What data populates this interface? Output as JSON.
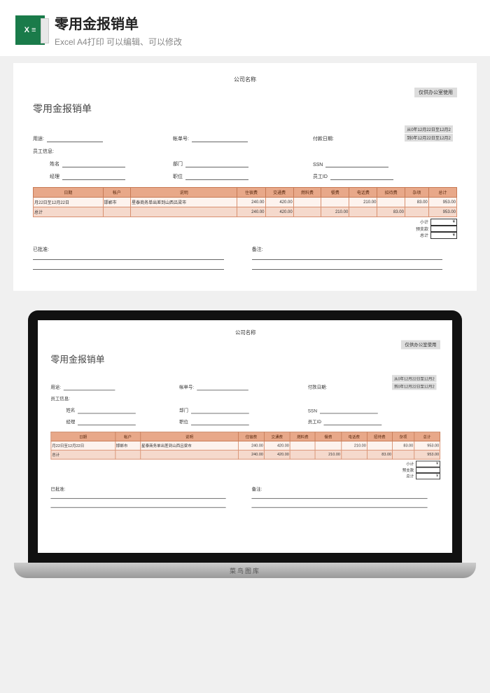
{
  "header": {
    "title": "零用金报销单",
    "subtitle": "Excel A4打印 可以编辑、可以修改"
  },
  "sheet": {
    "company": "公司名称",
    "topnote": "仅供办公室使用",
    "title": "零用金报销单",
    "purpose_label": "用途:",
    "statement_no_label": "帐单号:",
    "payperiod_label": "付款日期:",
    "from_prefix": "从",
    "to_prefix": "到",
    "date_value": "0年12月22日至12月2",
    "emp_label": "员工信息:",
    "name_label": "姓名",
    "dept_label": "部门",
    "ssn_label": "SSN",
    "mgr_label": "经理",
    "pos_label": "职位",
    "empid_label": "员工ID"
  },
  "table": {
    "headers": [
      "日期",
      "帐户",
      "说明",
      "住宿费",
      "交通费",
      "燃料费",
      "餐费",
      "电话费",
      "招待费",
      "杂项",
      "总计"
    ],
    "rows": [
      {
        "cells": [
          "月22日至12月22日",
          "邯郸市",
          "星泰商务单出差到山西吕梁市",
          "240.00",
          "420.00",
          "",
          "",
          "210.00",
          "",
          "83.00",
          "",
          "953.00"
        ]
      },
      {
        "cells": [
          "总计",
          "",
          "",
          "240.00",
          "420.00",
          "",
          "210.00",
          "",
          "83.00",
          "",
          "",
          "953.00"
        ]
      }
    ]
  },
  "summary": {
    "subtotal_label": "小计",
    "advance_label": "预支款",
    "total_label": "总计",
    "currency": "¥"
  },
  "footer": {
    "approved_label": "已批准:",
    "notes_label": "备注:"
  },
  "laptop": {
    "brand": "菜鸟图库"
  },
  "chart_data": {
    "type": "table",
    "title": "零用金报销单",
    "columns": [
      "日期",
      "帐户",
      "说明",
      "住宿费",
      "交通费",
      "燃料费",
      "餐费",
      "电话费",
      "招待费",
      "杂项",
      "总计"
    ],
    "rows": [
      [
        "月22日至12月22日",
        "邯郸市",
        "星泰商务单出差到山西吕梁市",
        240.0,
        420.0,
        null,
        null,
        210.0,
        null,
        83.0,
        null,
        953.0
      ],
      [
        "总计",
        "",
        "",
        240.0,
        420.0,
        null,
        210.0,
        null,
        83.0,
        null,
        null,
        953.0
      ]
    ],
    "summary": {
      "小计": null,
      "预支款": null,
      "总计": null
    }
  }
}
